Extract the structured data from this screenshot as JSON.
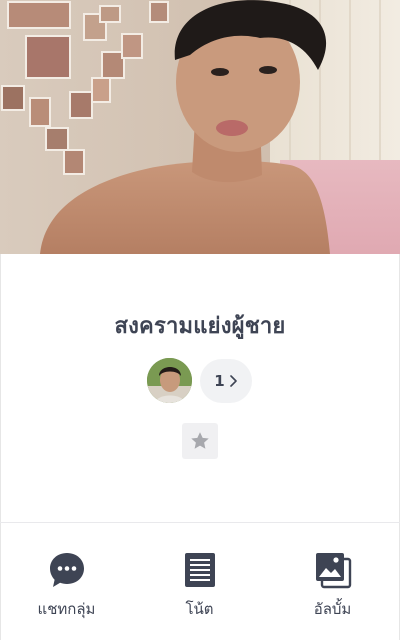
{
  "cover": {
    "icon": "cover-photo"
  },
  "group": {
    "name": "สงครามแย่งผู้ชาย",
    "member_count": "1",
    "member_avatar_icon": "member-avatar"
  },
  "favorite": {
    "icon": "star-icon"
  },
  "tabs": [
    {
      "label": "แชทกลุ่ม",
      "icon": "chat-bubble-icon"
    },
    {
      "label": "โน้ต",
      "icon": "note-icon"
    },
    {
      "label": "อัลบั้ม",
      "icon": "album-icon"
    }
  ],
  "colors": {
    "text": "#3e4454",
    "icon": "#3e4454",
    "pill_bg": "#f1f2f4",
    "star": "#a7a8ad"
  }
}
